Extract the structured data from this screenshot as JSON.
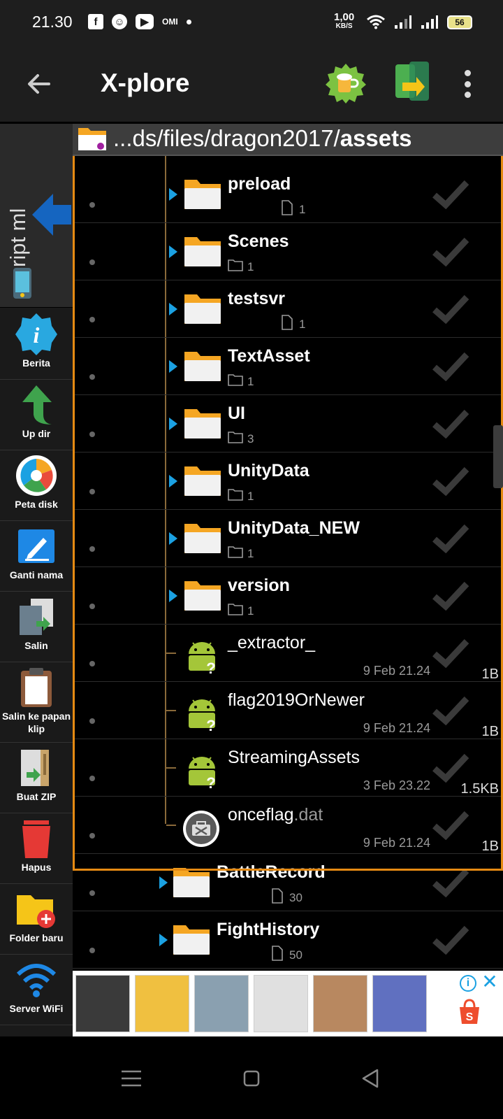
{
  "status_bar": {
    "time": "21.30",
    "icons": [
      "facebook-icon",
      "bitmoji-icon",
      "youtube-icon"
    ],
    "omi": "OMI",
    "speed_value": "1,00",
    "speed_unit": "KB/S",
    "battery": "56"
  },
  "toolbar": {
    "title": "X-plore"
  },
  "side_tab": {
    "label": "script ml"
  },
  "tools": [
    {
      "label": "Berita",
      "icon": "info-icon"
    },
    {
      "label": "Up dir",
      "icon": "up-arrow-icon"
    },
    {
      "label": "Peta disk",
      "icon": "disk-map-icon"
    },
    {
      "label": "Ganti nama",
      "icon": "rename-icon"
    },
    {
      "label": "Salin",
      "icon": "copy-icon"
    },
    {
      "label": "Salin ke papan klip",
      "icon": "clipboard-icon"
    },
    {
      "label": "Buat ZIP",
      "icon": "zip-icon"
    },
    {
      "label": "Hapus",
      "icon": "trash-icon"
    },
    {
      "label": "Folder baru",
      "icon": "new-folder-icon"
    },
    {
      "label": "Server WiFi",
      "icon": "wifi-server-icon"
    }
  ],
  "path": {
    "prefix": "...ds/files/dragon2017/",
    "current": "assets"
  },
  "files": [
    {
      "name": "preload",
      "kind": "folder",
      "count": "1",
      "count_icon": "file",
      "level": 1
    },
    {
      "name": "Scenes",
      "kind": "folder",
      "count": "1",
      "count_icon": "folder",
      "level": 1
    },
    {
      "name": "testsvr",
      "kind": "folder",
      "count": "1",
      "count_icon": "file",
      "level": 1
    },
    {
      "name": "TextAsset",
      "kind": "folder",
      "count": "1",
      "count_icon": "folder",
      "level": 1
    },
    {
      "name": "UI",
      "kind": "folder",
      "count": "3",
      "count_icon": "folder",
      "level": 1
    },
    {
      "name": "UnityData",
      "kind": "folder",
      "count": "1",
      "count_icon": "folder",
      "level": 1
    },
    {
      "name": "UnityData_NEW",
      "kind": "folder",
      "count": "1",
      "count_icon": "folder",
      "level": 1
    },
    {
      "name": "version",
      "kind": "folder",
      "count": "1",
      "count_icon": "folder",
      "level": 1
    },
    {
      "name": "_extractor_",
      "kind": "unknown",
      "date": "9 Feb 21.24",
      "size": "1B",
      "level": 1
    },
    {
      "name": "flag2019OrNewer",
      "kind": "unknown",
      "date": "9 Feb 21.24",
      "size": "1B",
      "level": 1
    },
    {
      "name": "StreamingAssets",
      "kind": "unknown",
      "date": "3 Feb 23.22",
      "size": "1.5KB",
      "level": 1
    },
    {
      "name": "onceflag",
      "ext": ".dat",
      "kind": "dat",
      "date": "9 Feb 21.24",
      "size": "1B",
      "level": 1
    },
    {
      "name": "BattleRecord",
      "kind": "folder",
      "count": "30",
      "count_icon": "file",
      "level": 0
    },
    {
      "name": "FightHistory",
      "kind": "folder",
      "count": "50",
      "count_icon": "file",
      "level": 0
    }
  ],
  "ad": {
    "brand": "Shopee",
    "thumbnails": [
      "#3a3a3a",
      "#f0c040",
      "#8aa0b0",
      "#e0e0e0",
      "#b88860",
      "#6070c0"
    ]
  },
  "colors": {
    "accent": "#e58a13",
    "expander": "#1ba1e2",
    "folder": "#f5a623"
  }
}
